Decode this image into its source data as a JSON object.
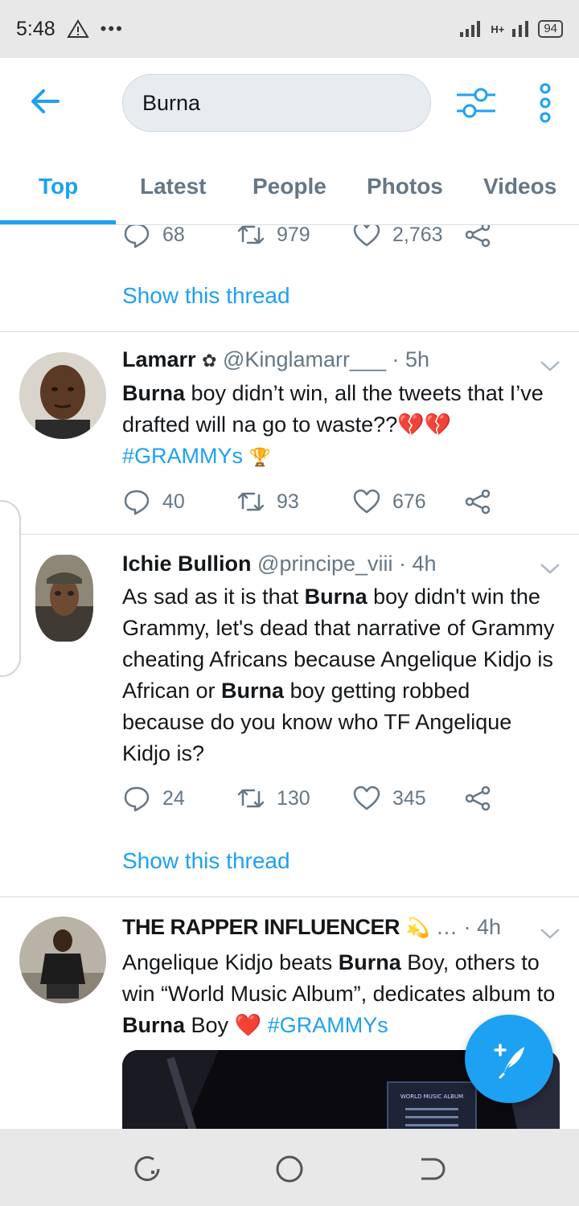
{
  "status_bar": {
    "time": "5:48",
    "alert_icon": "warning-triangle-icon",
    "overflow": "•••",
    "network": "H+",
    "battery": "94"
  },
  "search": {
    "query": "Burna"
  },
  "tabs": [
    {
      "label": "Top",
      "active": true
    },
    {
      "label": "Latest",
      "active": false
    },
    {
      "label": "People",
      "active": false
    },
    {
      "label": "Photos",
      "active": false
    },
    {
      "label": "Videos",
      "active": false
    }
  ],
  "colors": {
    "accent": "#1da1f2",
    "muted": "#657786",
    "broken_heart": "#d0263b"
  },
  "tweets": [
    {
      "partial": true,
      "replies": "68",
      "retweets": "979",
      "likes": "2,763",
      "show_thread": "Show this thread"
    },
    {
      "name": "Lamarr",
      "badge": "✿",
      "handle": "@Kinglamarr___",
      "time": "· 5h",
      "text_bold": "Burna",
      "text_rest": " boy didn’t win, all the tweets that I’ve drafted will na go to waste??",
      "emoji": "💔💔",
      "hashtag": "#GRAMMYs",
      "trophy": "🏆",
      "replies": "40",
      "retweets": "93",
      "likes": "676"
    },
    {
      "name": "Ichie Bullion",
      "handle": "@principe_viii",
      "time": "· 4h",
      "text_1": "As sad as it is that ",
      "text_bold_1": "Burna",
      "text_2": " boy didn't win the Grammy, let's dead that narrative of Grammy cheating Africans because Angelique Kidjo is African or ",
      "text_bold_2": "Burna",
      "text_3": " boy getting robbed because do you know who TF Angelique Kidjo is?",
      "replies": "24",
      "retweets": "130",
      "likes": "345",
      "show_thread": "Show this thread"
    },
    {
      "name": "THE RAPPER INFLUENCER",
      "emoji": "💫",
      "ellipsis": "…",
      "time": "· 4h",
      "text_1": "Angelique Kidjo beats ",
      "text_bold_1": "Burna",
      "text_2": " Boy, others to win “World Music Album”, dedicates album to ",
      "text_bold_2": "Burna",
      "text_3": " Boy ",
      "heart": "❤️",
      "hashtag": "#GRAMMYs"
    }
  ],
  "media_caption": "WORLD MUSIC ALBUM"
}
